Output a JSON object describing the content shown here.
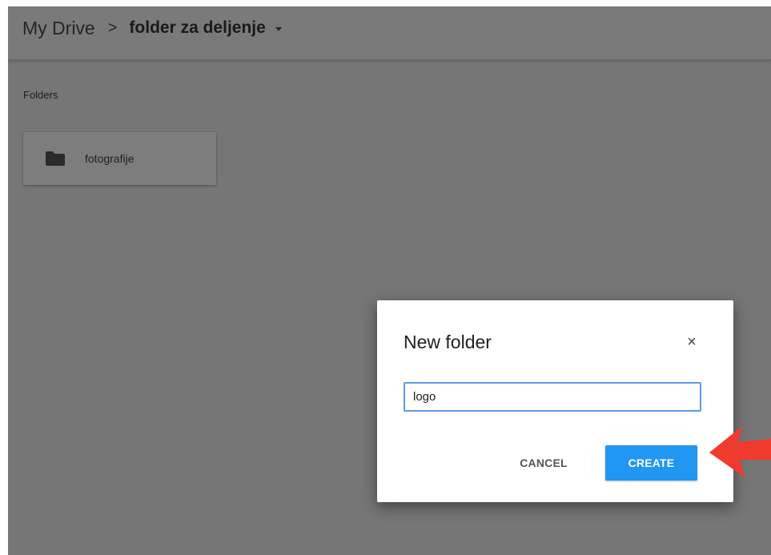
{
  "breadcrumb": {
    "root": "My Drive",
    "separator": ">",
    "current": "folder za deljenje"
  },
  "folders_section": {
    "label": "Folders",
    "items": [
      {
        "name": "fotografije",
        "icon": "folder-icon"
      }
    ]
  },
  "dialog": {
    "title": "New folder",
    "close_icon": "×",
    "input_value": "logo",
    "cancel_label": "CANCEL",
    "create_label": "CREATE"
  },
  "annotation": {
    "arrow_color": "#f03a2e",
    "points_to": "create-button"
  },
  "colors": {
    "overlay_bg": "#767676",
    "accent": "#2196f3",
    "input_border": "#5a9be8"
  }
}
